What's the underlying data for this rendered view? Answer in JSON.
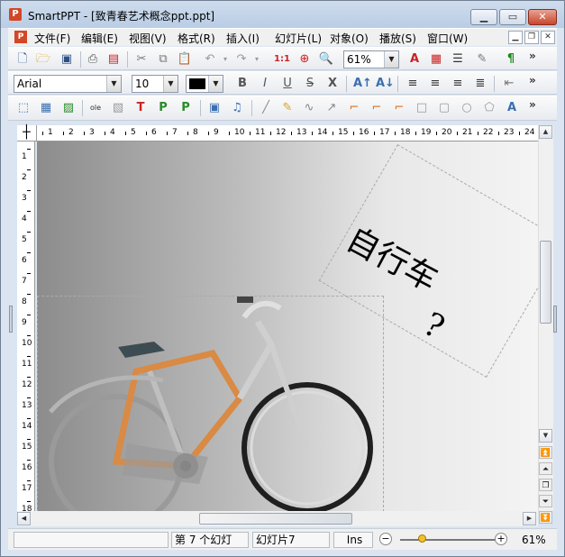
{
  "window": {
    "app_name": "SmartPPT",
    "title": "SmartPPT - [致青春艺术概念ppt.ppt]",
    "controls": [
      "minimize",
      "maximize",
      "close"
    ]
  },
  "menu": {
    "items": [
      "文件(F)",
      "编辑(E)",
      "视图(V)",
      "格式(R)",
      "插入(I)",
      "幻灯片(L)",
      "对象(O)",
      "播放(S)",
      "窗口(W)"
    ]
  },
  "toolbar1": {
    "zoom_value": "61%",
    "icons": [
      "new-icon",
      "open-icon",
      "save-icon",
      "print-icon",
      "pdf-icon",
      "cut-icon",
      "copy-icon",
      "paste-icon",
      "undo-icon",
      "redo-icon",
      "slide-size-icon",
      "zoom-search-icon",
      "find-icon",
      "zoom-combo",
      "text-a-icon",
      "notes-icon",
      "outline-icon",
      "brush-icon",
      "paragraph-icon"
    ]
  },
  "toolbar2": {
    "font_name": "Arial",
    "font_size": "10",
    "color": "#000000",
    "buttons": [
      "B",
      "I",
      "U",
      "S",
      "X"
    ]
  },
  "toolbar3": {
    "icons": [
      "select-icon",
      "table-icon",
      "image-icon",
      "ole-icon",
      "chart-icon",
      "text-t-icon",
      "text-p-icon",
      "text-p2-icon",
      "movie-icon",
      "sound-icon",
      "line-icon",
      "pencil-icon",
      "curve-icon",
      "arrow-icon",
      "connector-icon",
      "connector2-icon",
      "connector3-icon",
      "rect-icon",
      "roundrect-icon",
      "ellipse-icon",
      "shapes-icon",
      "wordart-icon"
    ]
  },
  "ruler": {
    "h_labels": [
      "1",
      "2",
      "3",
      "4",
      "5",
      "6",
      "7",
      "8",
      "9",
      "10",
      "11",
      "12",
      "13",
      "14",
      "15",
      "16",
      "17",
      "18",
      "19",
      "20",
      "21",
      "22",
      "23",
      "24"
    ],
    "v_labels": [
      "1",
      "2",
      "3",
      "4",
      "5",
      "6",
      "7",
      "8",
      "9",
      "10",
      "11",
      "12",
      "13",
      "14",
      "15",
      "16",
      "17",
      "18"
    ]
  },
  "slide": {
    "text": "自行车?",
    "text_line1": "自行车",
    "text_line2": "?"
  },
  "statusbar": {
    "panel_empty": "",
    "slide_index": "第 7 个幻灯",
    "slide_name": "幻灯片7",
    "mode": "Ins",
    "zoom": "61%"
  }
}
